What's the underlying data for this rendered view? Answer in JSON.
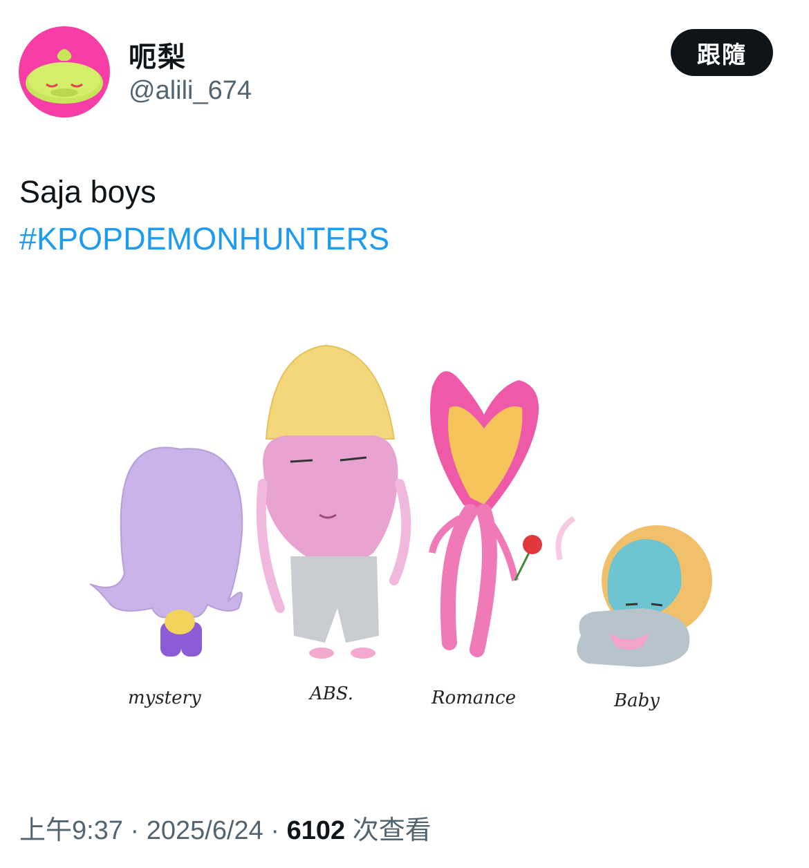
{
  "author": {
    "display_name": "呃梨",
    "handle": "@alili_674",
    "avatar_icon": "avatar-plush-icon"
  },
  "follow_button": {
    "label": "跟隨"
  },
  "tweet": {
    "text": "Saja boys",
    "hashtag": "#KPOPDEMONHUNTERS"
  },
  "media": {
    "labels": [
      "mystery",
      "ABS.",
      "Romance",
      "Baby"
    ]
  },
  "meta": {
    "time": "上午9:37",
    "separator": " · ",
    "date": "2025/6/24",
    "views_count": "6102",
    "views_label": " 次查看"
  },
  "colors": {
    "accent": "#1d9bf0",
    "button_bg": "#0f1419",
    "avatar_bg": "#f73ea6"
  }
}
